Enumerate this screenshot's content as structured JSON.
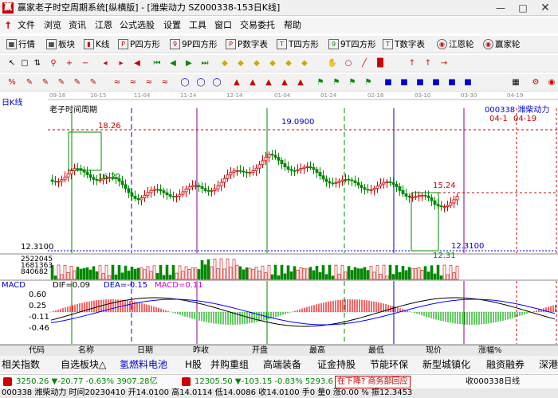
{
  "window": {
    "title": "赢家老子时空周期系统[纵横版] - [潍柴动力 SZ000338-153日K线]",
    "icon": "赢",
    "buttons": [
      "minimize-icon",
      "maximize-icon",
      "close-icon"
    ]
  },
  "menu": {
    "items": [
      "文件",
      "浏览",
      "资讯",
      "江恩",
      "公式选股",
      "设置",
      "工具",
      "窗口",
      "交易委托",
      "帮助"
    ]
  },
  "toolbar1": {
    "items": [
      "行情",
      "板块",
      "K线",
      "P四方形",
      "9P四方形",
      "P数字表",
      "T四方形",
      "9T四方形",
      "T数字表",
      "江恩轮",
      "赢家轮"
    ]
  },
  "chart": {
    "panel_label": "日K线",
    "indicator_title": "老子时间周期",
    "stock_info": "000338  潍柴动力",
    "date_marker": "04-1",
    "date_marker2": "04-19",
    "date_ticks": [
      "09-16",
      "10-15",
      "11-04",
      "11-24",
      "12-14",
      "01-04",
      "01-24",
      "02-18",
      "03-10",
      "03-30",
      "04-19"
    ],
    "price_labels": {
      "high_left": "18.26",
      "low_left": "16.22",
      "peak": "19.0900",
      "level_right": "15.24",
      "low_right": "12.3100",
      "low_right2": "12.31",
      "axis_low": "12.3100"
    },
    "volume_labels": [
      "2522045",
      "1681363",
      "840682"
    ]
  },
  "macd": {
    "title": "MACD",
    "dif_label": "DIF=0.09",
    "dea_label": "DEA=-0.15",
    "macd_label": "MACD=0.11",
    "ticks": [
      "0.60",
      "0.25",
      "-0.11",
      "-0.46"
    ],
    "colors": {
      "dif": "#000000",
      "dea": "#0000ff",
      "macd_pos": "#ff0000",
      "macd_neg": "#00a000"
    }
  },
  "tabs": [
    "代码",
    "名称",
    "日期",
    "昨收",
    "开盘",
    "最高",
    "最低",
    "现价",
    "涨幅%"
  ],
  "quickbar": {
    "items": [
      "相关指数",
      "自选板块△",
      "氢燃料电池",
      "H股",
      "并购重组",
      "高端装备",
      "证金持股",
      "节能环保",
      "新型城镇化",
      "融资融券",
      "深港"
    ]
  },
  "indexbar": {
    "items": [
      "3250.26 ▼-20.77 -0.63% 3907.28亿",
      "12305.50 ▼-103.15 -0.83% 5293.6",
      "在下降? 商务部回应",
      "收000338日线"
    ]
  },
  "statusbar": {
    "text": "000338 潍柴动力 时间20230410 开14.0100 高14.0114 低14.0086 收14.0100 手0 量0 涨0.00 % 振12.3453"
  }
}
